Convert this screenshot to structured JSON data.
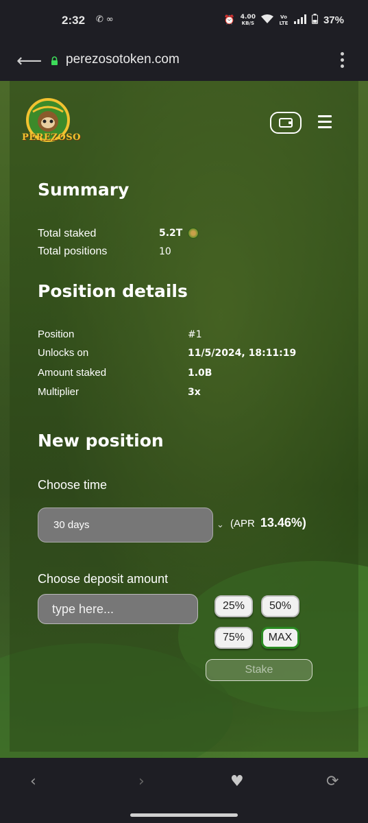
{
  "status_bar": {
    "time": "2:32",
    "net_speed": "4.00",
    "net_unit": "KB/S",
    "volte": "Vo LTE",
    "battery": "37%"
  },
  "browser": {
    "url": "perezosotoken.com"
  },
  "header": {
    "logo_text": "PEREZOSO"
  },
  "summary": {
    "title": "Summary",
    "total_staked_label": "Total staked",
    "total_staked_value": "5.2T",
    "total_positions_label": "Total positions",
    "total_positions_value": "10"
  },
  "position_details": {
    "title": "Position details",
    "rows": [
      {
        "label": "Position",
        "value": "#1"
      },
      {
        "label": "Unlocks on",
        "value": "11/5/2024, 18:11:19"
      },
      {
        "label": "Amount staked",
        "value": "1.0B"
      },
      {
        "label": "Multiplier",
        "value": "3x"
      }
    ]
  },
  "new_position": {
    "title": "New position",
    "choose_time_label": "Choose time",
    "time_selected": "30 days",
    "apr_prefix": "(APR",
    "apr_value": "13.46%)",
    "deposit_label": "Choose deposit amount",
    "deposit_placeholder": "type here...",
    "pct_buttons": [
      "25%",
      "50%",
      "75%",
      "MAX"
    ],
    "stake_label": "Stake"
  }
}
